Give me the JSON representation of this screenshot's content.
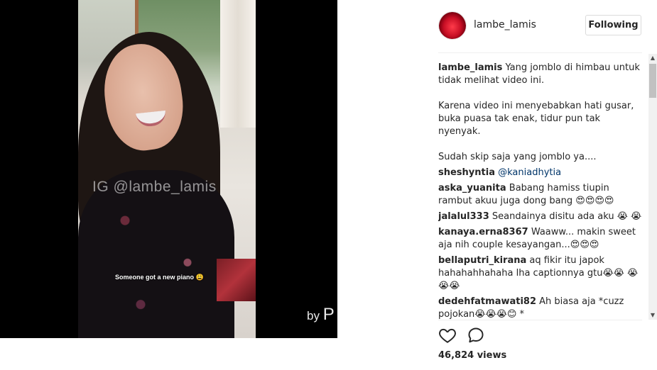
{
  "media": {
    "watermark": "IG @lambe_lamis",
    "video_caption": "Someone got a new piano 😩",
    "by_text": "by",
    "by_letter": "P"
  },
  "header": {
    "username": "lambe_lamis",
    "follow_label": "Following",
    "avatar_icon": "lips-avatar-icon"
  },
  "caption": {
    "username": "lambe_lamis",
    "line1": "Yang jomblo di himbau untuk tidak melihat video ini.",
    "line2": "Karena video ini menyebabkan hati gusar, buka puasa tak enak, tidur pun tak nyenyak.",
    "line3": "Sudah skip saja yang jomblo ya...."
  },
  "comments": [
    {
      "user": "sheshyntia",
      "text": "@kaniadhytia",
      "is_mention": true
    },
    {
      "user": "aska_yuanita",
      "text": "Babang hamiss tiupin rambut akuu juga dong bang 😍😍😍😍"
    },
    {
      "user": "jalalul333",
      "text": "Seandainya disitu ada aku 😭 😭"
    },
    {
      "user": "kanaya.erna8367",
      "text": "Waaww... makin sweet aja nih couple kesayangan...😍😍😍"
    },
    {
      "user": "bellaputri_kirana",
      "text": "aq fikir itu japok hahahahhahaha lha captionnya gtu😭😭 😭😭😭"
    },
    {
      "user": "dedehfatmawati82",
      "text": "Ah biasa aja *cuzz pojokan😭😭😭😊 *"
    }
  ],
  "actions": {
    "like_icon": "heart-icon",
    "comment_icon": "comment-bubble-icon"
  },
  "views": "46,824 views",
  "colors": {
    "text": "#262626",
    "mention": "#003569",
    "border": "#dbdbdb"
  }
}
